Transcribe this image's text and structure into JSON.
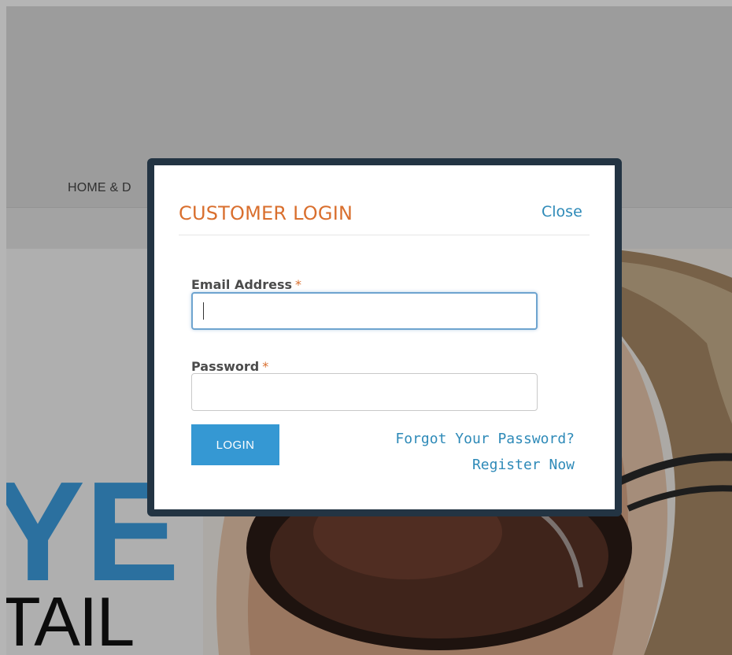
{
  "background_page": {
    "nav_text": "HOME & D",
    "hero_big_text": "YE",
    "hero_small_text": "TAIL"
  },
  "modal": {
    "title": "CUSTOMER LOGIN",
    "close_label": "Close",
    "email": {
      "label": "Email Address",
      "required_mark": "*",
      "value": "",
      "placeholder": ""
    },
    "password": {
      "label": "Password",
      "required_mark": "*",
      "value": "",
      "placeholder": ""
    },
    "login_label": "LOGIN",
    "forgot_password_label": "Forgot Your Password?",
    "register_label": "Register Now"
  },
  "colors": {
    "accent_title": "#d96f2e",
    "link": "#2e8ab8",
    "button": "#3598d3",
    "modal_border": "#233443",
    "hero_text": "#3d9ee0"
  }
}
